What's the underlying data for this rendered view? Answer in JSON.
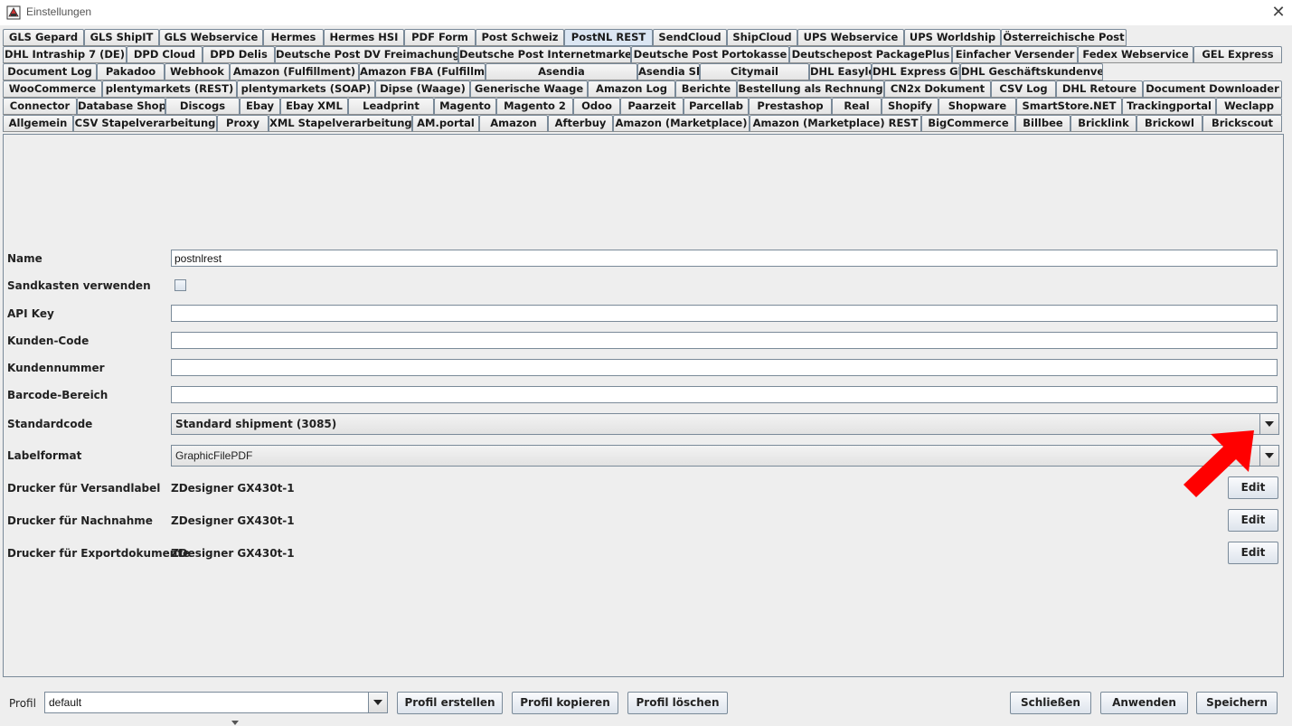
{
  "window": {
    "title": "Einstellungen",
    "close_glyph": "✕"
  },
  "tabs": {
    "row1": [
      "GLS Gepard",
      "GLS ShipIT",
      "GLS Webservice",
      "Hermes",
      "Hermes HSI",
      "PDF Form",
      "Post Schweiz",
      "PostNL REST",
      "SendCloud",
      "ShipCloud",
      "UPS Webservice",
      "UPS Worldship",
      "Österreichische Post"
    ],
    "row2": [
      "DHL Intraship 7 (DE)",
      "DPD Cloud",
      "DPD Delis",
      "Deutsche Post DV Freimachung",
      "Deutsche Post Internetmarke",
      "Deutsche Post Portokasse",
      "Deutschepost PackagePlus",
      "Einfacher Versender",
      "Fedex Webservice",
      "GEL Express"
    ],
    "row3": [
      "Document Log",
      "Pakadoo",
      "Webhook",
      "Amazon (Fulfillment)",
      "Amazon FBA (Fulfillment)",
      "Asendia",
      "Asendia Shipping",
      "Citymail",
      "DHL Easylog",
      "DHL Express Global WS",
      "DHL Geschäftskundenversand"
    ],
    "row4": [
      "WooCommerce",
      "plentymarkets (REST)",
      "plentymarkets (SOAP)",
      "Dipse (Waage)",
      "Generische Waage",
      "Amazon Log",
      "Berichte",
      "Bestellung als Rechnung",
      "CN2x Dokument",
      "CSV Log",
      "DHL Retoure",
      "Document Downloader"
    ],
    "row5": [
      "Connector",
      "Database Shop",
      "Discogs",
      "Ebay",
      "Ebay XML",
      "Leadprint",
      "Magento",
      "Magento 2",
      "Odoo",
      "Paarzeit",
      "Parcellab",
      "Prestashop",
      "Real",
      "Shopify",
      "Shopware",
      "SmartStore.NET",
      "Trackingportal",
      "Weclapp"
    ],
    "row6": [
      "Allgemein",
      "CSV Stapelverarbeitung",
      "Proxy",
      "XML Stapelverarbeitung",
      "AM.portal",
      "Amazon",
      "Afterbuy",
      "Amazon (Marketplace)",
      "Amazon (Marketplace) REST",
      "BigCommerce",
      "Billbee",
      "Bricklink",
      "Brickowl",
      "Brickscout"
    ],
    "active": "PostNL REST"
  },
  "form": {
    "name_label": "Name",
    "name_value": "postnlrest",
    "sandbox_label": "Sandkasten verwenden",
    "sandbox_checked": false,
    "apikey_label": "API Key",
    "apikey_value": "",
    "kundencode_label": "Kunden-Code",
    "kundencode_value": "",
    "kundennummer_label": "Kundennummer",
    "kundennummer_value": "",
    "barcode_label": "Barcode-Bereich",
    "barcode_value": "",
    "standardcode_label": "Standardcode",
    "standardcode_value": "Standard shipment (3085)",
    "labelformat_label": "Labelformat",
    "labelformat_value": "GraphicFilePDF",
    "printer_label_label": "Drucker für Versandlabel",
    "printer_label_value": "ZDesigner GX430t-1",
    "printer_cod_label": "Drucker für Nachnahme",
    "printer_cod_value": "ZDesigner GX430t-1",
    "printer_export_label": "Drucker für Exportdokumente",
    "printer_export_value": "ZDesigner GX430t-1",
    "edit_label": "Edit"
  },
  "footer": {
    "profil_label": "Profil",
    "profil_value": "default",
    "create_label": "Profil erstellen",
    "copy_label": "Profil kopieren",
    "delete_label": "Profil löschen",
    "close_label": "Schließen",
    "apply_label": "Anwenden",
    "save_label": "Speichern"
  },
  "colors": {
    "annotation_arrow": "#ff0000",
    "active_tab": "#dbe6f3"
  }
}
